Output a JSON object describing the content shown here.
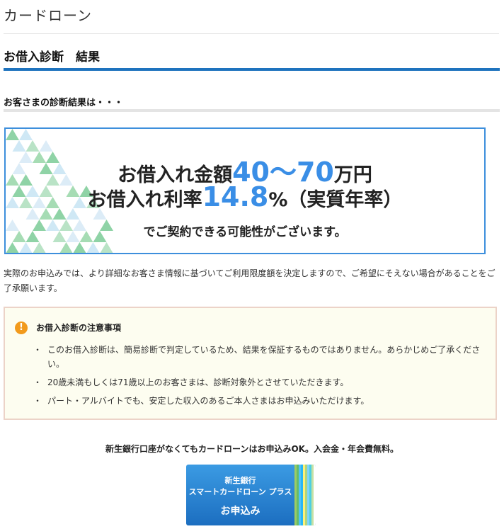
{
  "app": {
    "title": "カードローン"
  },
  "section": {
    "title": "お借入診断　結果"
  },
  "result": {
    "subtitle": "お客さまの診断結果は・・・",
    "amount_label": "お借入れ金額",
    "amount_value": "40～70",
    "amount_unit": "万円",
    "rate_label": "お借入れ利率",
    "rate_value": "14.8",
    "rate_unit": "%（実質年率）",
    "closing": "でご契約できる可能性がございます。",
    "accent_color": "#3a8ee6"
  },
  "explanation": "実際のお申込みでは、より詳細なお客さま情報に基づいてご利用限度額を決定しますので、ご希望にそえない場合があることをご了承願います。",
  "notice": {
    "icon": "exclamation-icon",
    "title": "お借入診断の注意事項",
    "items": [
      "このお借入診断は、簡易診断で判定しているため、結果を保証するものではありません。あらかじめご了承ください。",
      "20歳未満もしくは71歳以上のお客さまは、診断対象外とさせていただきます。",
      "パート・アルバイトでも、安定した収入のあるご本人さまはお申込みいただけます。"
    ]
  },
  "promo": {
    "text": "新生銀行口座がなくてもカードローンはお申込みOK。入会金・年会費無料。"
  },
  "apply_button": {
    "line1": "新生銀行",
    "line2": "スマートカードローン プラス",
    "line3": "お申込み",
    "stripe_colors": [
      "#9ccc65",
      "#66bb6a",
      "#4fc3f7",
      "#29b6f6",
      "#fff176",
      "#aed581",
      "#81d4fa",
      "#4dd0e1",
      "#c5e1a5",
      "#ffffff"
    ]
  }
}
